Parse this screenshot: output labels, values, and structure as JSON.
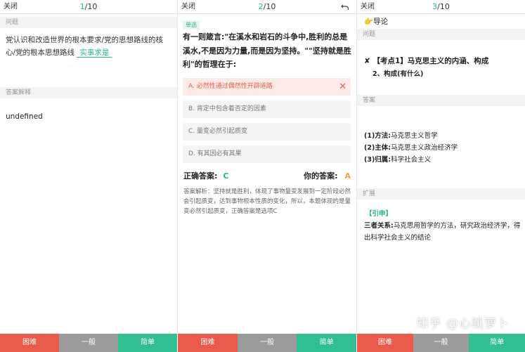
{
  "panel1": {
    "close": "关闭",
    "counter_cur": "1",
    "counter_total": "/10",
    "section_question": "问题",
    "question_text": "党认识和改造世界的根本要求/党的思想路线的核心/党的根本思想路线",
    "blank_answer": "实事求是",
    "section_explain": "答案解释",
    "answer_text": "undefined",
    "buttons": {
      "hard": "困难",
      "normal": "一般",
      "easy": "简单"
    }
  },
  "panel2": {
    "close": "关闭",
    "counter_cur": "2",
    "counter_total": "/10",
    "undo_icon": "undo-icon",
    "tag": "单选",
    "stem": "有一则箴言:\"在溪水和岩石的斗争中,胜利的总是溪水,不是因为力量,而是因为坚持。\"\"坚持就是胜利\"的哲理在于:",
    "options": [
      {
        "label": "A. 必然性通过偶然性开辟道路",
        "state": "wrong"
      },
      {
        "label": "B. 肯定中包含着否定的因素",
        "state": "normal"
      },
      {
        "label": "C. 量变必然引起质变",
        "state": "normal"
      },
      {
        "label": "D. 有其因必有其果",
        "state": "normal"
      }
    ],
    "correct_label": "正确答案:",
    "correct_value": "C",
    "your_label": "你的答案:",
    "your_value": "A",
    "analysis": "答案解析：坚持就是胜利，体现了事物量变发展到一定阶段必然会引起质变，达到事物根本性质的变化，所以，本题体现的是量变必然引起质变，正确答案是选项C",
    "buttons": {
      "hard": "困难",
      "normal": "一般",
      "easy": "简单"
    }
  },
  "panel3": {
    "close": "关闭",
    "counter_cur": "3",
    "counter_total": "/10",
    "guide_icon": "pointing-hand-icon",
    "guide": "导论",
    "section_question": "问题",
    "keypoint": "【考点1】马克思主义的内涵、构成",
    "keypoint_sub": "2、构成(有什么)",
    "section_answer": "答案",
    "answer_lines": [
      {
        "num": "(1)方法:",
        "text": "马克思主义哲学"
      },
      {
        "num": "(2)主体:",
        "text": "马克思主义政治经济学"
      },
      {
        "num": "(3)归属:",
        "text": "科学社会主义"
      }
    ],
    "section_extend": "扩展",
    "extend_tag": "【引申】",
    "extend_title": "三者关系:",
    "extend_line1": "马克思用哲学的方法，研究政治经济学，得",
    "extend_line2": "出科学社会主义的结论",
    "buttons": {
      "hard": "困难",
      "normal": "一般",
      "easy": "简单"
    }
  },
  "watermark": "知乎 @心跳萝卜",
  "colors": {
    "accent_green": "#2cb48c",
    "hard_red": "#ea5a4a",
    "normal_gray": "#9b9b9b",
    "easy_green": "#2fbf93",
    "wrong_bg": "#fde9e6"
  }
}
